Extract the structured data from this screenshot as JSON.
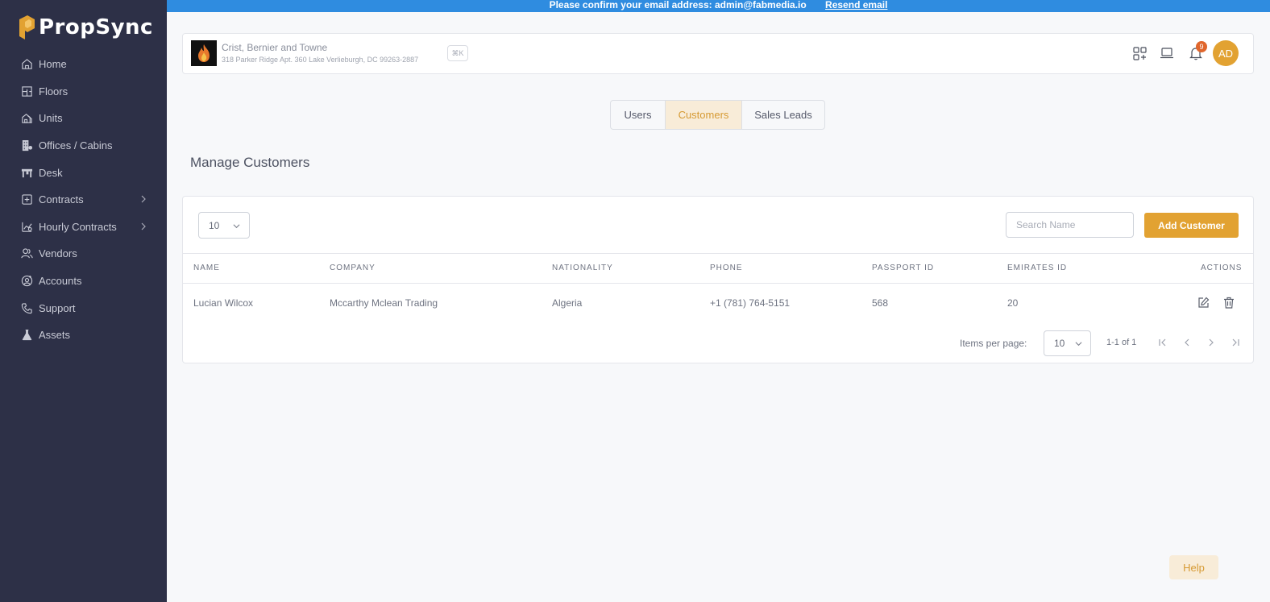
{
  "app": {
    "name": "PropSync"
  },
  "banner": {
    "message": "Please confirm your email address: admin@fabmedia.io",
    "link": "Resend email"
  },
  "sidebar": {
    "items": [
      {
        "label": "Home",
        "icon": "home-icon"
      },
      {
        "label": "Floors",
        "icon": "floor-plan-icon"
      },
      {
        "label": "Units",
        "icon": "units-icon"
      },
      {
        "label": "Offices / Cabins",
        "icon": "building-icon"
      },
      {
        "label": "Desk",
        "icon": "desk-icon"
      },
      {
        "label": "Contracts",
        "icon": "contract-icon",
        "expandable": true
      },
      {
        "label": "Hourly Contracts",
        "icon": "hourly-contract-icon",
        "expandable": true
      },
      {
        "label": "Vendors",
        "icon": "users-icon"
      },
      {
        "label": "Accounts",
        "icon": "account-icon"
      },
      {
        "label": "Support",
        "icon": "phone-icon"
      },
      {
        "label": "Assets",
        "icon": "flask-icon"
      }
    ]
  },
  "header": {
    "org_name": "Crist, Bernier and Towne",
    "org_address": "318 Parker Ridge Apt. 360 Lake Verlieburgh, DC 99263-2887",
    "shortcut": "⌘K",
    "notification_count": "9",
    "avatar_initials": "AD"
  },
  "tabs": [
    {
      "label": "Users",
      "active": false
    },
    {
      "label": "Customers",
      "active": true
    },
    {
      "label": "Sales Leads",
      "active": false
    }
  ],
  "page_title": "Manage Customers",
  "controls": {
    "page_size": "10",
    "search_placeholder": "Search Name",
    "add_button": "Add Customer"
  },
  "table": {
    "columns": [
      "NAME",
      "COMPANY",
      "NATIONALITY",
      "PHONE",
      "PASSPORT ID",
      "EMIRATES ID",
      "ACTIONS"
    ],
    "rows": [
      [
        "Lucian Wilcox",
        "Mccarthy Mclean Trading",
        "Algeria",
        "+1 (781) 764-5151",
        "568",
        "20"
      ]
    ]
  },
  "pagination": {
    "items_per_page_label": "Items per page:",
    "items_per_page": "10",
    "range": "1-1 of 1"
  },
  "help_label": "Help",
  "colors": {
    "sidebar": "#2d3047",
    "accent": "#e2a232",
    "banner": "#2f8ce0",
    "active_tab_bg": "#f8ecd8"
  }
}
